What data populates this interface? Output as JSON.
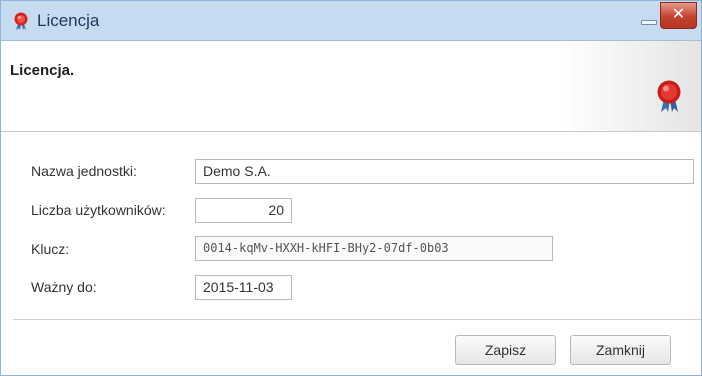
{
  "window": {
    "title": "Licencja",
    "icon": "license-seal-icon"
  },
  "header": {
    "title": "Licencja.",
    "icon": "license-seal-icon"
  },
  "form": {
    "unit_name": {
      "label": "Nazwa jednostki:",
      "value": "Demo S.A."
    },
    "user_count": {
      "label": "Liczba użytkowników:",
      "value": "20"
    },
    "key": {
      "label": "Klucz:",
      "value": "0014-kqMv-HXXH-kHFI-BHy2-07df-0b03"
    },
    "valid_until": {
      "label": "Ważny do:",
      "value": "2015-11-03"
    }
  },
  "footer": {
    "save_label": "Zapisz",
    "close_label": "Zamknij"
  },
  "colors": {
    "titlebar": "#c6dbf0",
    "close_button": "#c4432f",
    "seal_red": "#d8241c"
  }
}
